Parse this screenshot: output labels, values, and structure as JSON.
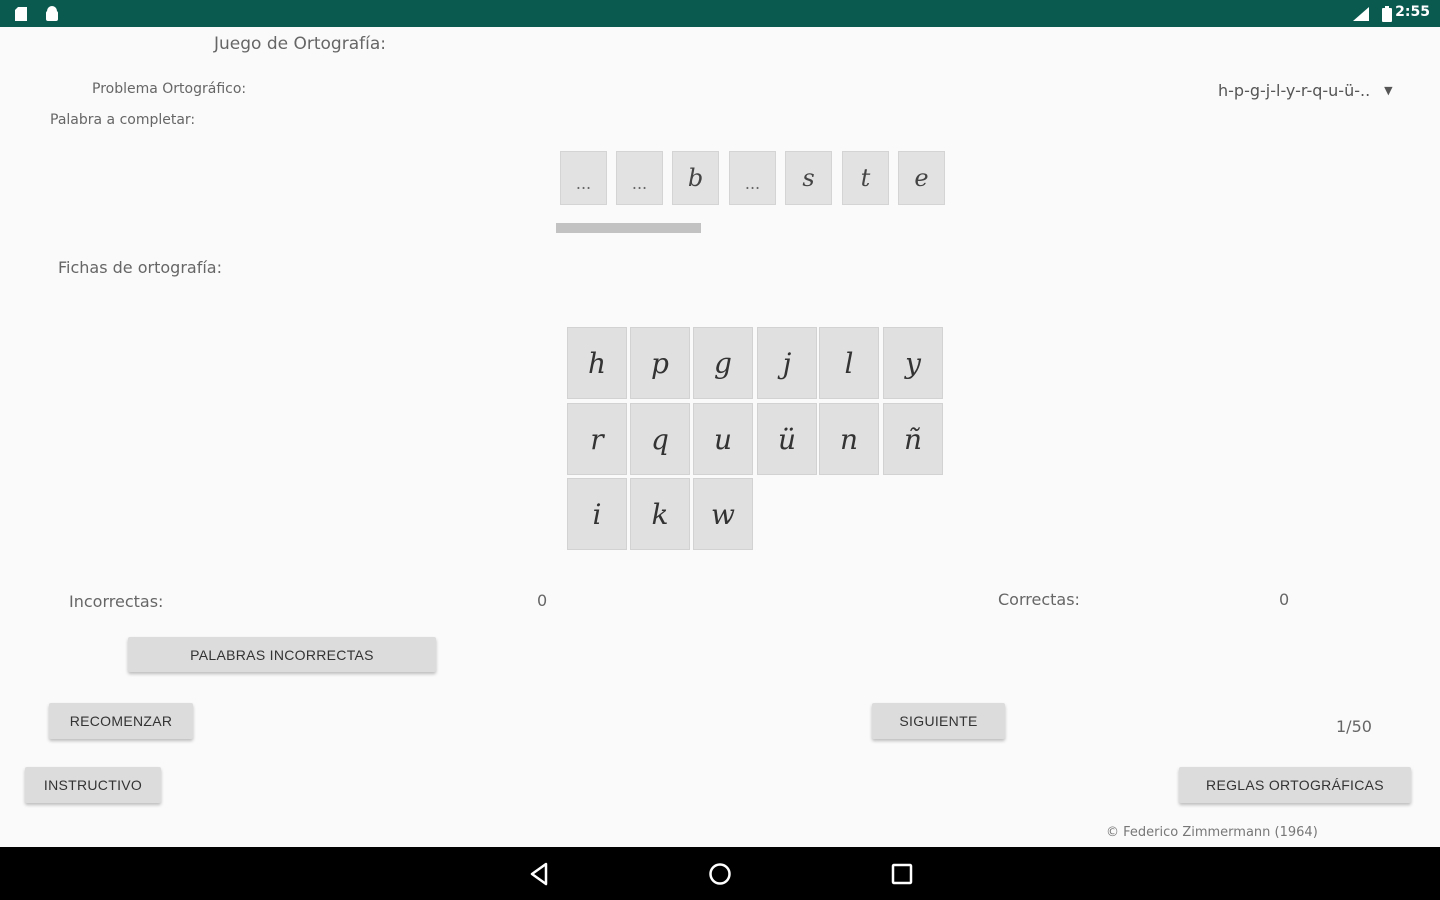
{
  "status_bar": {
    "time": "2:55",
    "color": "#0b5a50"
  },
  "header": {
    "title": "Juego de Ortografía:"
  },
  "problem": {
    "label": "Problema Ortográfico:",
    "selected": "h-p-g-j-l-y-r-q-u-ü-.."
  },
  "word": {
    "label": "Palabra a completar:",
    "slots": [
      "...",
      "...",
      "b",
      "...",
      "s",
      "t",
      "e"
    ]
  },
  "tiles": {
    "label": "Fichas de ortografía:",
    "rows": [
      [
        "h",
        "p",
        "g",
        "j",
        "l",
        "y"
      ],
      [
        "r",
        "q",
        "u",
        "ü",
        "n",
        "ñ"
      ],
      [
        "i",
        "k",
        "w"
      ]
    ]
  },
  "score": {
    "incorrect_label": "Incorrectas:",
    "incorrect_value": "0",
    "correct_label": "Correctas:",
    "correct_value": "0"
  },
  "buttons": {
    "wrong_words": "PALABRAS INCORRECTAS",
    "restart": "RECOMENZAR",
    "next": "SIGUIENTE",
    "instructions": "INSTRUCTIVO",
    "rules": "REGLAS ORTOGRÁFICAS"
  },
  "progress": {
    "text": "1/50"
  },
  "footer": {
    "copyright": "© Federico Zimmermann (1964)"
  },
  "icons": [
    "sim-card-icon",
    "android-icon",
    "signal-icon",
    "battery-icon",
    "nav-back-icon",
    "nav-home-icon",
    "nav-recents-icon",
    "dropdown-caret-icon"
  ]
}
